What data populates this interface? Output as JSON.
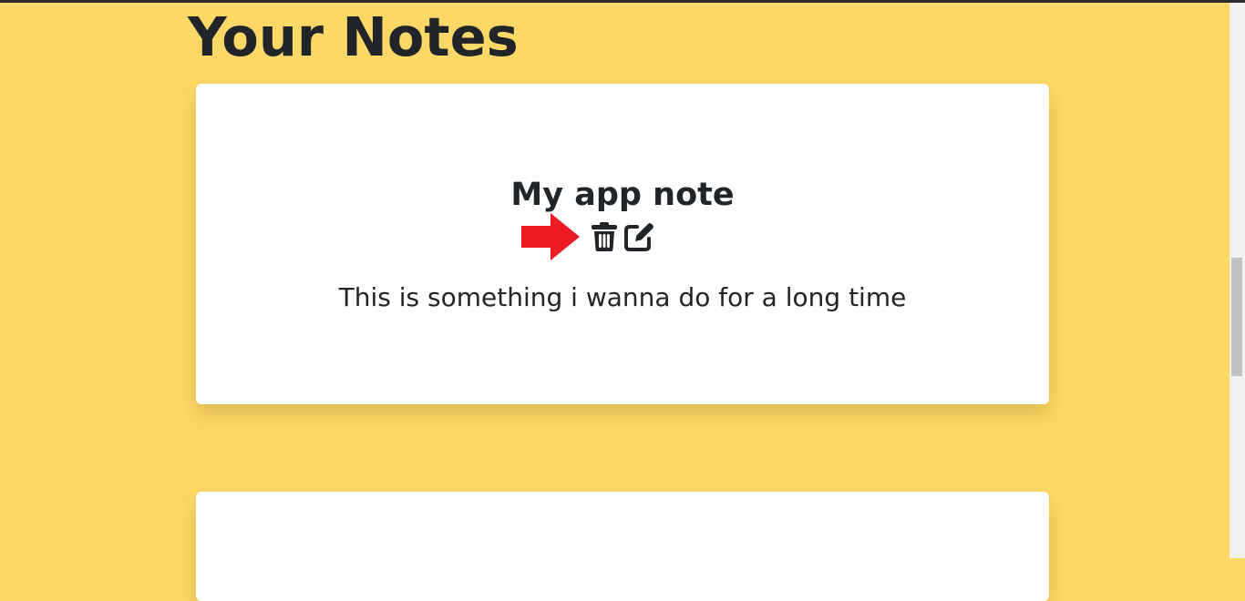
{
  "page": {
    "title": "Your Notes"
  },
  "notes": [
    {
      "title": "My app note",
      "body": "This is something i wanna do for a long time",
      "actions": {
        "delete_icon": "trash-icon",
        "edit_icon": "pen-to-square-icon"
      }
    }
  ],
  "annotation": {
    "icon": "red-arrow-icon",
    "color": "#ed1c24"
  },
  "colors": {
    "background": "#fed866",
    "card": "#ffffff",
    "text": "#212529"
  }
}
